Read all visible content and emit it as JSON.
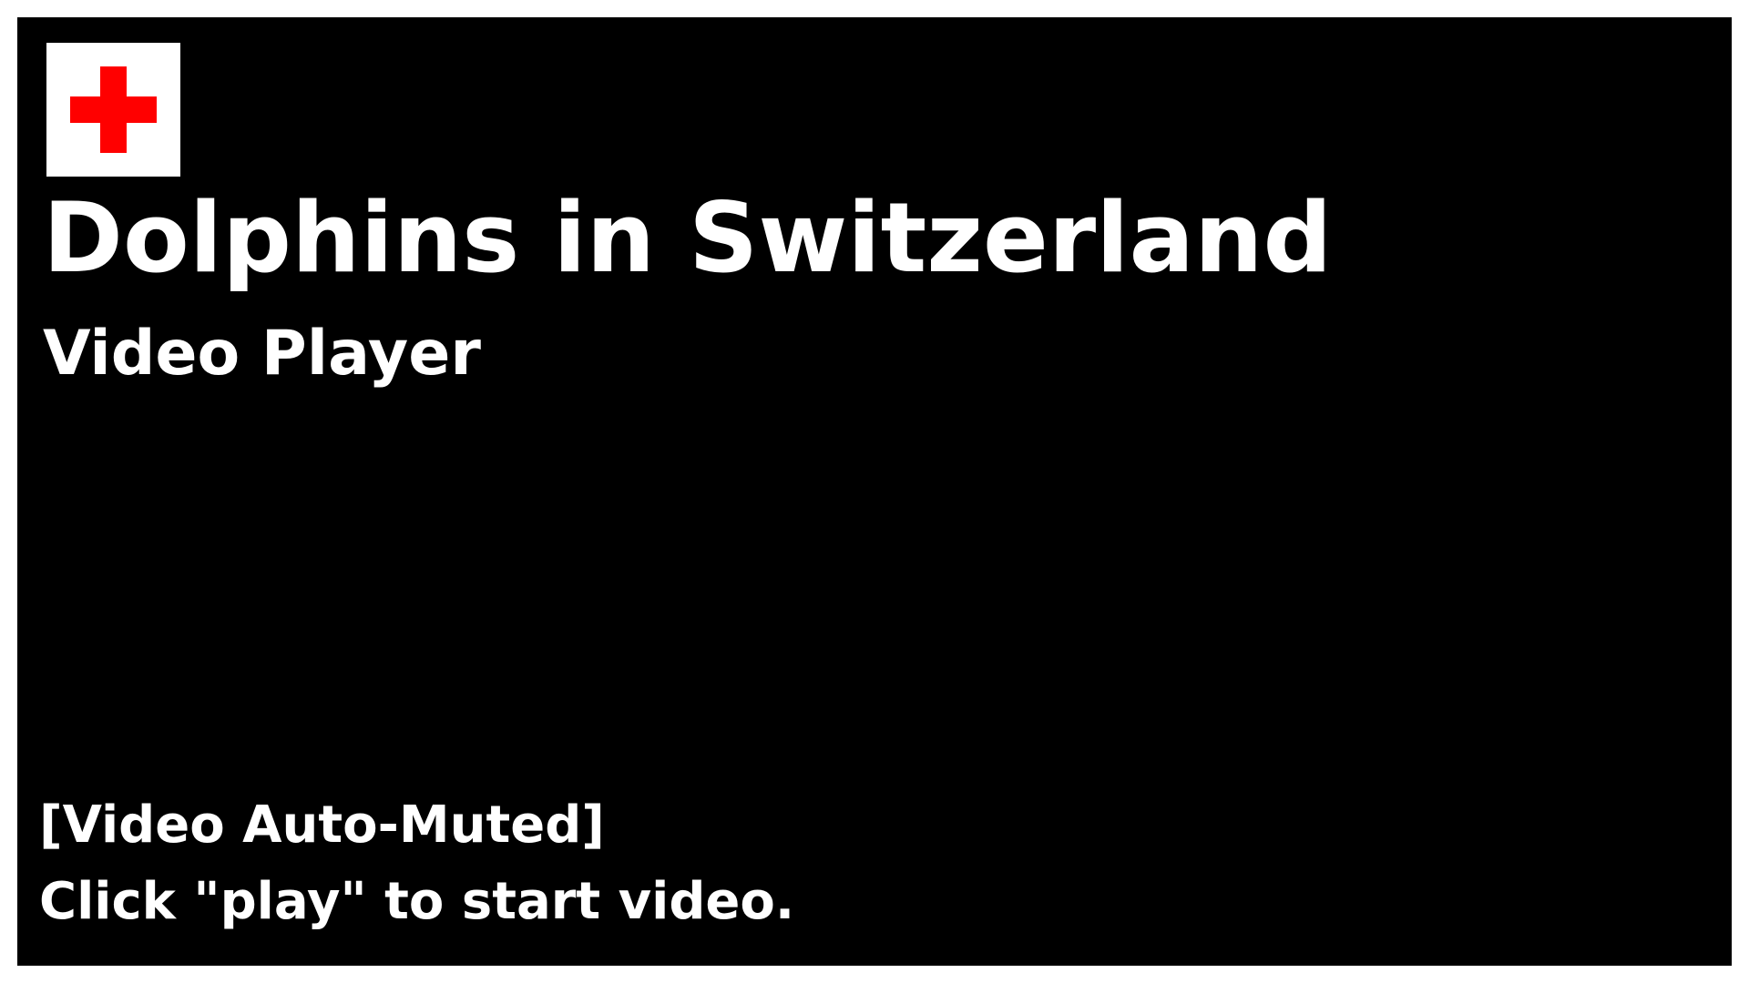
{
  "video": {
    "title": "Dolphins in Switzerland",
    "subtitle": "Video Player",
    "muted_notice": "[Video Auto-Muted]",
    "play_hint": "Click \"play\" to start video."
  },
  "flag": {
    "icon": "swiss-flag-icon",
    "background_color": "#ffffff",
    "cross_color": "#ff0000"
  },
  "colors": {
    "player_background": "#000000",
    "text": "#ffffff",
    "page_background": "#ffffff"
  }
}
